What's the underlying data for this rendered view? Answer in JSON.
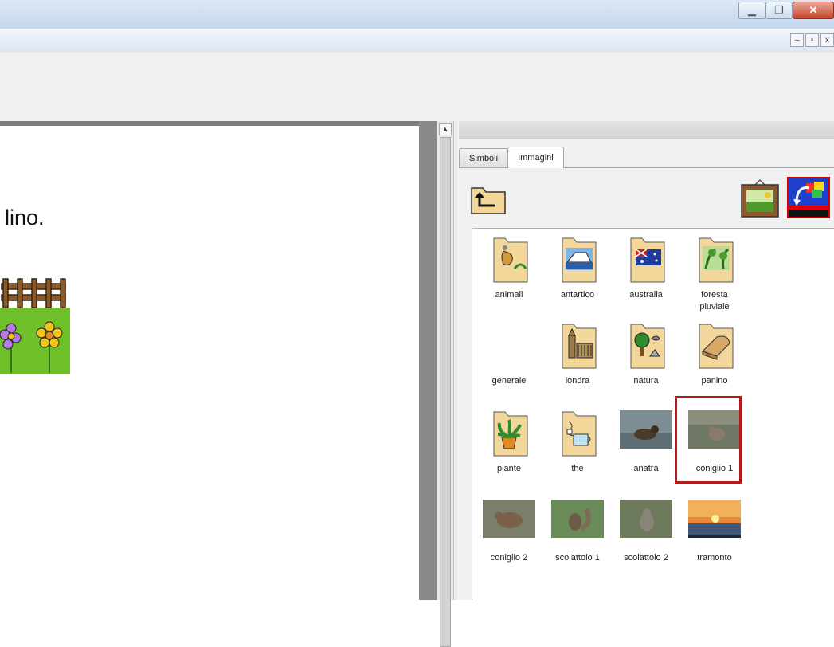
{
  "document": {
    "text_fragment": "lino."
  },
  "panel": {
    "tabs": [
      {
        "label": "Simboli",
        "active": false
      },
      {
        "label": "Immagini",
        "active": true
      }
    ],
    "selected_item": "coniglio 1",
    "items": [
      {
        "label": "animali",
        "type": "folder",
        "icon": "kangaroo-folder-icon"
      },
      {
        "label": "antartico",
        "type": "folder",
        "icon": "iceberg-ship-folder-icon"
      },
      {
        "label": "australia",
        "type": "folder",
        "icon": "australia-flag-folder-icon"
      },
      {
        "label": "foresta\npluviale",
        "type": "folder",
        "icon": "rainforest-folder-icon"
      },
      {
        "label": "generale",
        "type": "folder",
        "icon": "empty-folder"
      },
      {
        "label": "londra",
        "type": "folder",
        "icon": "big-ben-folder-icon"
      },
      {
        "label": "natura",
        "type": "folder",
        "icon": "tree-bird-folder-icon"
      },
      {
        "label": "panino",
        "type": "folder",
        "icon": "bread-folder-icon"
      },
      {
        "label": "piante",
        "type": "folder",
        "icon": "potted-plant-folder-icon"
      },
      {
        "label": "the",
        "type": "folder",
        "icon": "teacup-folder-icon"
      },
      {
        "label": "anatra",
        "type": "photo",
        "icon": "duck-photo"
      },
      {
        "label": "coniglio 1",
        "type": "photo",
        "icon": "rabbit-photo"
      },
      {
        "label": "coniglio 2",
        "type": "photo",
        "icon": "rabbit-photo"
      },
      {
        "label": "scoiattolo 1",
        "type": "photo",
        "icon": "squirrel-photo"
      },
      {
        "label": "scoiattolo 2",
        "type": "photo",
        "icon": "squirrel-photo"
      },
      {
        "label": "tramonto",
        "type": "photo",
        "icon": "sunset-photo"
      }
    ]
  },
  "colors": {
    "folder": "#f3d69a",
    "selection": "#b31b1b",
    "garden_grass": "#6fbf2a",
    "change_button_border": "#cc0000"
  }
}
